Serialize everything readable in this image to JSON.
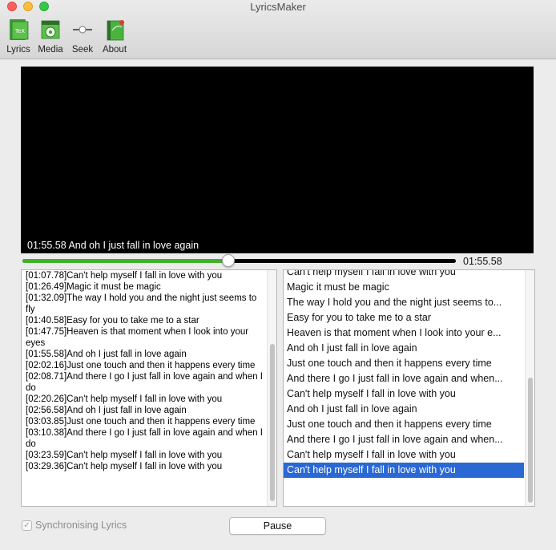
{
  "window": {
    "title": "LyricsMaker"
  },
  "toolbar": {
    "items": [
      {
        "label": "Lyrics",
        "icon": "lyrics-tex-icon",
        "icon_text": "TeX"
      },
      {
        "label": "Media",
        "icon": "media-film-icon"
      },
      {
        "label": "Seek",
        "icon": "seek-slider-icon"
      },
      {
        "label": "About",
        "icon": "about-book-icon"
      }
    ]
  },
  "video": {
    "caption": "01:55.58 And oh I just fall in love again"
  },
  "seek": {
    "progress": 0.475,
    "time": "01:55.58",
    "fill_color": "#43b02a"
  },
  "left_panel": {
    "lines": [
      "[01:07.78]Can't help myself I fall in love with you",
      "[01:26.49]Magic it must be magic",
      "[01:32.09]The way I hold you and the night just seems to fly",
      "[01:40.58]Easy for you to take me to a star",
      "[01:47.75]Heaven is that moment when I look into your eyes",
      "[01:55.58]And oh I just fall in love again",
      "[02:02.16]Just one touch and then it happens every time",
      "[02:08.71]And there I go I just fall in love again and when I do",
      "[02:20.26]Can't help myself I fall in love with you",
      "[02:56.58]And oh I just fall in love again",
      "[03:03.85]Just one touch and then it happens every time",
      "[03:10.38]And there I go I just fall in love again and when I do",
      "[03:23.59]Can't help myself I fall in love with you",
      "[03:29.36]Can't help myself I fall in love with you"
    ]
  },
  "right_panel": {
    "rows": [
      "Can't help myself I fall in love with you",
      "Magic it must be magic",
      "The way I hold you and the night just seems to...",
      "Easy for you to take me to a star",
      "Heaven is that moment when I look into your e...",
      "And oh I just fall in love again",
      "Just one touch and then it happens every time",
      "And there I go I just fall in love again and when...",
      "Can't help myself I fall in love with you",
      "And oh I just fall in love again",
      "Just one touch and then it happens every time",
      "And there I go I just fall in love again and when...",
      "Can't help myself I fall in love with you",
      "Can't help myself I fall in love with you"
    ],
    "selected_index": 13,
    "selection_color": "#2a68d3"
  },
  "footer": {
    "sync_label": "Synchronising Lyrics",
    "sync_checked": true,
    "pause_label": "Pause"
  }
}
